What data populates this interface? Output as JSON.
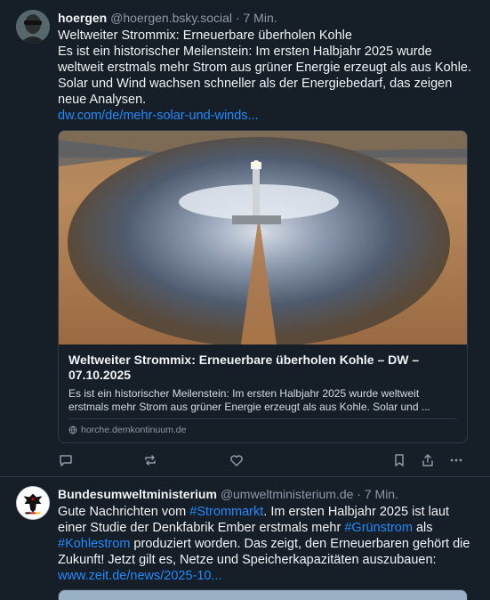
{
  "posts": [
    {
      "author_name": "hoergen",
      "author_handle": "@hoergen.bsky.social",
      "separator": "·",
      "time": "7 Min.",
      "text_line1": "Weltweiter Strommix: Erneuerbare überholen Kohle",
      "text_body": "Es ist ein historischer Meilenstein: Im ersten Halbjahr 2025 wurde weltweit erstmals mehr Strom aus grüner Energie erzeugt als aus Kohle. Solar und Wind wachsen schneller als der Energiebedarf, das zeigen neue Analysen.",
      "link": "dw.com/de/mehr-solar-und-winds...",
      "card": {
        "title": "Weltweiter Strommix: Erneuerbare überholen Kohle – DW – 07.10.2025",
        "description": "Es ist ein historischer Meilenstein: Im ersten Halbjahr 2025 wurde weltweit erstmals mehr Strom aus grüner Energie erzeugt als aus Kohle. Solar und ...",
        "domain": "horche.demkontinuum.de"
      },
      "actions": [
        "reply-icon",
        "repost-icon",
        "like-icon",
        "bookmark-icon",
        "share-icon",
        "more-icon"
      ]
    },
    {
      "author_name": "Bundesumweltministerium",
      "author_handle": "@umweltministerium.de",
      "separator": "·",
      "time": "7 Min.",
      "text_part1": "Gute Nachrichten vom ",
      "tag1": "#Strommarkt",
      "text_part2": ". Im ersten Halbjahr 2025 ist laut einer Studie der Denkfabrik Ember erstmals mehr ",
      "tag2": "#Grünstrom",
      "text_part3": " als ",
      "tag3": "#Kohlestrom",
      "text_part4": " produziert worden. Das zeigt, den Erneuerbaren gehört die Zukunft! Jetzt gilt es, Netze und Speicherkapazitäten auszubauen:",
      "link": "www.zeit.de/news/2025-10..."
    }
  ],
  "colors": {
    "background": "#161e27",
    "link": "#208bfe",
    "muted": "#8d9aa8",
    "border": "#2e3a47"
  }
}
